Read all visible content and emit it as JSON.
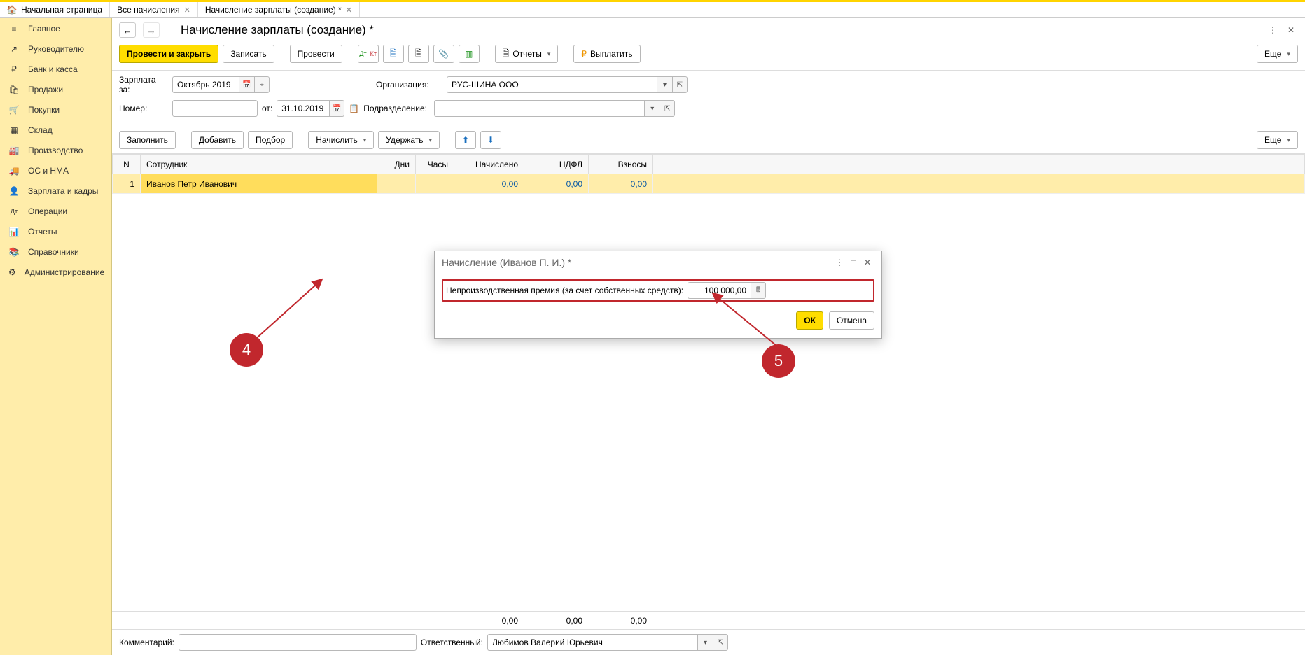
{
  "tabs": {
    "home": "Начальная страница",
    "t1": "Все начисления",
    "t2": "Начисление зарплаты (создание) *"
  },
  "sidebar": [
    {
      "label": "Главное",
      "icon": "≡"
    },
    {
      "label": "Руководителю",
      "icon": "↗"
    },
    {
      "label": "Банк и касса",
      "icon": "₽"
    },
    {
      "label": "Продажи",
      "icon": "🛍"
    },
    {
      "label": "Покупки",
      "icon": "🛒"
    },
    {
      "label": "Склад",
      "icon": "▦"
    },
    {
      "label": "Производство",
      "icon": "🏭"
    },
    {
      "label": "ОС и НМА",
      "icon": "🚚"
    },
    {
      "label": "Зарплата и кадры",
      "icon": "👤"
    },
    {
      "label": "Операции",
      "icon": "Дт"
    },
    {
      "label": "Отчеты",
      "icon": "📊"
    },
    {
      "label": "Справочники",
      "icon": "📚"
    },
    {
      "label": "Администрирование",
      "icon": "⚙"
    }
  ],
  "pageTitle": "Начисление зарплаты (создание) *",
  "toolbar": {
    "postClose": "Провести и закрыть",
    "save": "Записать",
    "post": "Провести",
    "reports": "Отчеты",
    "pay": "Выплатить",
    "more": "Еще"
  },
  "form": {
    "periodLabel": "Зарплата за:",
    "periodValue": "Октябрь 2019",
    "orgLabel": "Организация:",
    "orgValue": "РУС-ШИНА ООО",
    "numLabel": "Номер:",
    "numValue": "",
    "fromLabel": "от:",
    "dateValue": "31.10.2019",
    "deptLabel": "Подразделение:",
    "deptValue": ""
  },
  "tableToolbar": {
    "fill": "Заполнить",
    "add": "Добавить",
    "pick": "Подбор",
    "accrue": "Начислить",
    "deduct": "Удержать"
  },
  "table": {
    "cols": {
      "n": "N",
      "emp": "Сотрудник",
      "days": "Дни",
      "hours": "Часы",
      "accrued": "Начислено",
      "ndfl": "НДФЛ",
      "contrib": "Взносы"
    },
    "rows": [
      {
        "n": "1",
        "emp": "Иванов Петр Иванович",
        "days": "",
        "hours": "",
        "accrued": "0,00",
        "ndfl": "0,00",
        "contrib": "0,00"
      }
    ],
    "totals": {
      "accrued": "0,00",
      "ndfl": "0,00",
      "contrib": "0,00"
    }
  },
  "footer": {
    "commentLabel": "Комментарий:",
    "commentValue": "",
    "respLabel": "Ответственный:",
    "respValue": "Любимов Валерий Юрьевич"
  },
  "modal": {
    "title": "Начисление (Иванов П. И.) *",
    "fieldLabel": "Непроизводственная премия (за счет собственных средств):",
    "fieldValue": "100 000,00",
    "ok": "ОК",
    "cancel": "Отмена"
  },
  "callouts": {
    "c4": "4",
    "c5": "5"
  }
}
